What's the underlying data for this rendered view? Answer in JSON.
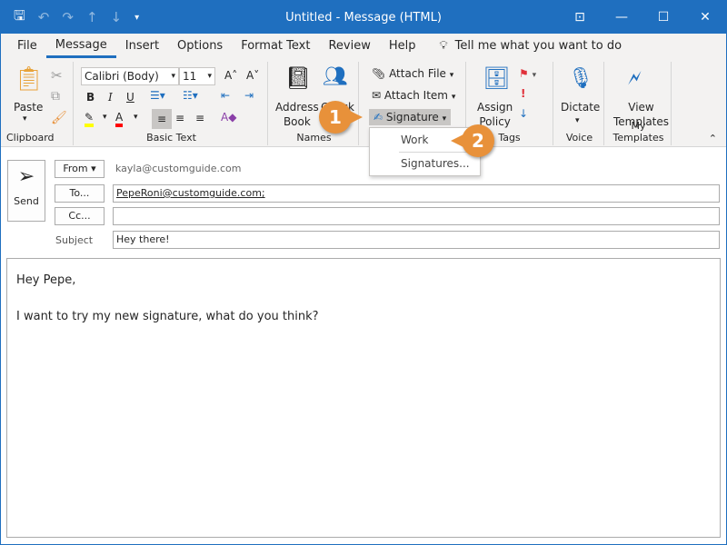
{
  "title": "Untitled  -  Message (HTML)",
  "menu": {
    "items": [
      "File",
      "Message",
      "Insert",
      "Options",
      "Format Text",
      "Review",
      "Help"
    ],
    "active": "Message",
    "tell_me": "Tell me what you want to do"
  },
  "ribbon": {
    "clipboard": {
      "label": "Clipboard",
      "paste": "Paste"
    },
    "basic_text": {
      "label": "Basic Text",
      "font": "Calibri (Body)",
      "size": "11",
      "bold": "B",
      "italic": "I",
      "underline": "U",
      "highlight_color": "#ffff00",
      "font_color": "#ff0000"
    },
    "names": {
      "label": "Names",
      "address_book_1": "Address",
      "address_book_2": "Book",
      "check_names": "Check"
    },
    "include": {
      "attach_file": "Attach File",
      "attach_item": "Attach Item",
      "signature": "Signature"
    },
    "tags": {
      "label": "Tags",
      "assign_1": "Assign",
      "assign_2": "Policy"
    },
    "voice": {
      "label": "Voice",
      "dictate": "Dictate"
    },
    "templates": {
      "label": "My Templates",
      "view_1": "View",
      "view_2": "Templates"
    }
  },
  "signature_menu": {
    "items": [
      "Work",
      "Signatures..."
    ]
  },
  "callouts": [
    "1",
    "2"
  ],
  "compose": {
    "send": "Send",
    "from_label": "From",
    "from_value": "kayla@customguide.com",
    "to_label": "To...",
    "to_value": "PepeRoni@customguide.com;",
    "cc_label": "Cc...",
    "cc_value": "",
    "subject_label": "Subject",
    "subject_value": "Hey there!"
  },
  "body": {
    "lines": [
      "Hey Pepe,",
      "I want to try my new signature, what do you think?"
    ]
  },
  "colors": {
    "accent": "#1f6fbf",
    "callout": "#e8913a"
  }
}
